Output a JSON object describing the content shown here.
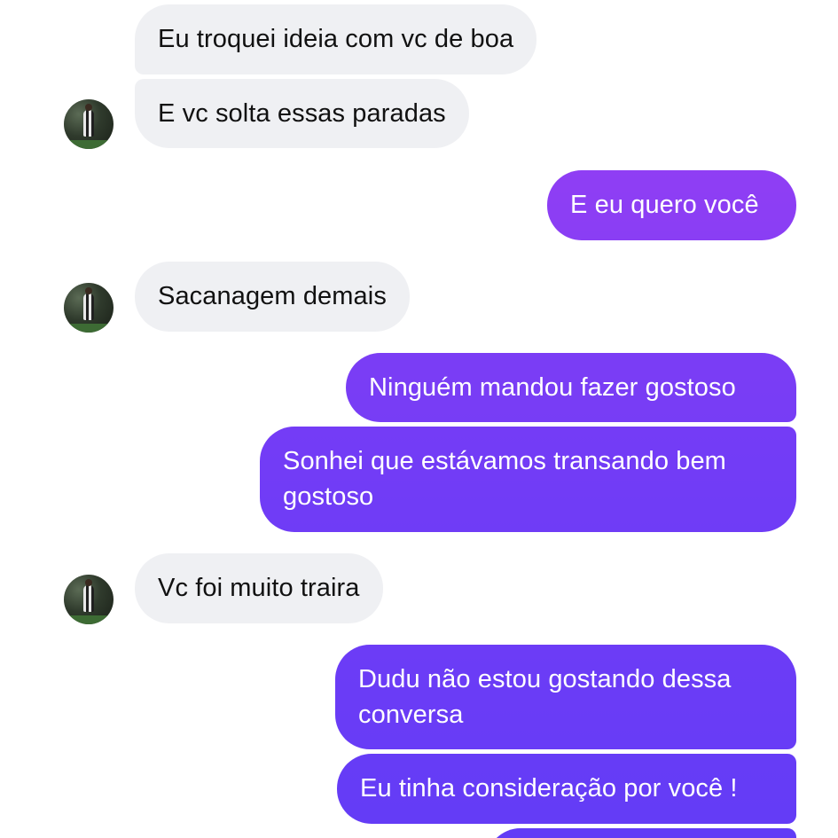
{
  "colors": {
    "incoming_bubble": "#eff0f3",
    "outgoing_gradient": [
      "#a23ff3",
      "#6b3cf6"
    ]
  },
  "messages": [
    {
      "from": "them",
      "text": "Eu troquei ideia com vc de boa"
    },
    {
      "from": "them",
      "text": "E vc solta essas paradas"
    },
    {
      "from": "me",
      "text": "E eu quero você"
    },
    {
      "from": "them",
      "text": "Sacanagem demais"
    },
    {
      "from": "me",
      "text": "Ninguém mandou fazer gostoso"
    },
    {
      "from": "me",
      "text": "Sonhei que estávamos transando bem gostoso"
    },
    {
      "from": "them",
      "text": "Vc foi muito traira"
    },
    {
      "from": "me",
      "text": "Dudu não estou gostando dessa conversa"
    },
    {
      "from": "me",
      "text": "Eu tinha consideração por você !"
    }
  ],
  "avatar": {
    "icon": "contact-avatar-photo"
  }
}
